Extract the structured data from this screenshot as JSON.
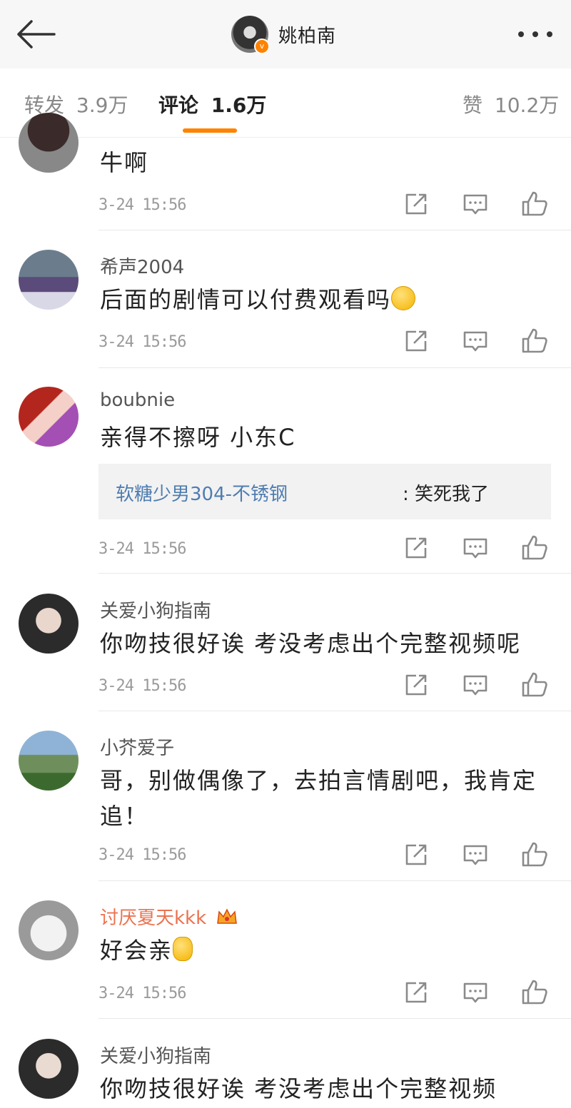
{
  "header": {
    "title": "姚柏南"
  },
  "tabs": [
    {
      "label": "转发",
      "count": "3.9万"
    },
    {
      "label": "评论",
      "count": "1.6万"
    },
    {
      "label": "赞",
      "count": "10.2万"
    }
  ],
  "comments": [
    {
      "username": "",
      "content": "牛啊",
      "time": "3-24 15:56"
    },
    {
      "username": "希声2004",
      "content": "后面的剧情可以付费观看吗",
      "time": "3-24 15:56"
    },
    {
      "username": "boubnie",
      "content": "亲得不擦呀 小东C",
      "time": "3-24 15:56",
      "reply": {
        "user": "软糖少男304-不锈钢",
        "text": ": 笑死我了"
      }
    },
    {
      "username": "关爱小狗指南",
      "content": "你吻技很好诶 考没考虑出个完整视频呢",
      "time": "3-24 15:56"
    },
    {
      "username": "小芥爱子",
      "content": "哥，别做偶像了，去拍言情剧吧，我肯定追！",
      "time": "3-24 15:56"
    },
    {
      "username": "讨厌夏天kkk",
      "content": "好会亲",
      "time": "3-24 15:56"
    },
    {
      "username": "关爱小狗指南",
      "content": "你吻技很好诶 考没考虑出个完整视频",
      "time": ""
    }
  ],
  "colors": {
    "accent": "#ff8200",
    "reply_user": "#4f7db0",
    "vip_name": "#eb7350"
  }
}
